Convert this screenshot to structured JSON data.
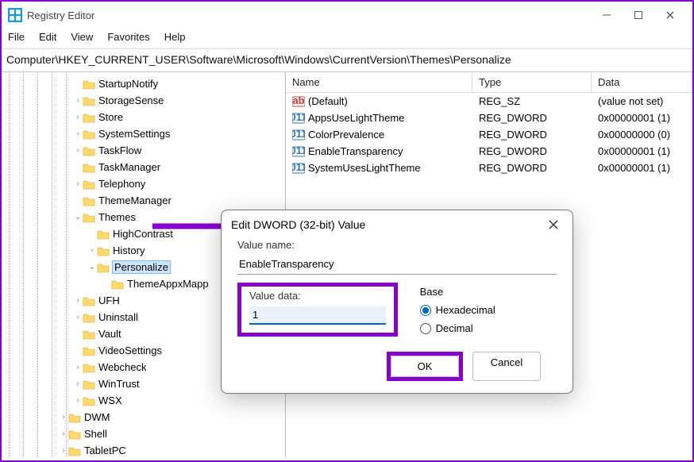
{
  "window": {
    "title": "Registry Editor"
  },
  "menu": {
    "file": "File",
    "edit": "Edit",
    "view": "View",
    "favorites": "Favorites",
    "help": "Help"
  },
  "path": "Computer\\HKEY_CURRENT_USER\\Software\\Microsoft\\Windows\\CurrentVersion\\Themes\\Personalize",
  "columns": {
    "name": "Name",
    "type": "Type",
    "data": "Data"
  },
  "values": [
    {
      "icon": "ab",
      "name": "(Default)",
      "type": "REG_SZ",
      "data": "(value not set)"
    },
    {
      "icon": "bin",
      "name": "AppsUseLightTheme",
      "type": "REG_DWORD",
      "data": "0x00000001 (1)"
    },
    {
      "icon": "bin",
      "name": "ColorPrevalence",
      "type": "REG_DWORD",
      "data": "0x00000000 (0)"
    },
    {
      "icon": "bin",
      "name": "EnableTransparency",
      "type": "REG_DWORD",
      "data": "0x00000001 (1)"
    },
    {
      "icon": "bin",
      "name": "SystemUsesLightTheme",
      "type": "REG_DWORD",
      "data": "0x00000001 (1)"
    }
  ],
  "tree": {
    "nodes": [
      {
        "depth": 4,
        "exp": "",
        "label": "StartupNotify"
      },
      {
        "depth": 4,
        "exp": ">",
        "label": "StorageSense"
      },
      {
        "depth": 4,
        "exp": ">",
        "label": "Store"
      },
      {
        "depth": 4,
        "exp": ">",
        "label": "SystemSettings"
      },
      {
        "depth": 4,
        "exp": ">",
        "label": "TaskFlow"
      },
      {
        "depth": 4,
        "exp": "",
        "label": "TaskManager"
      },
      {
        "depth": 4,
        "exp": ">",
        "label": "Telephony"
      },
      {
        "depth": 4,
        "exp": "",
        "label": "ThemeManager"
      },
      {
        "depth": 4,
        "exp": "v",
        "label": "Themes"
      },
      {
        "depth": 5,
        "exp": "",
        "label": "HighContrast"
      },
      {
        "depth": 5,
        "exp": ">",
        "label": "History"
      },
      {
        "depth": 5,
        "exp": "v",
        "label": "Personalize",
        "selected": true
      },
      {
        "depth": 6,
        "exp": "",
        "label": "ThemeAppxMapp"
      },
      {
        "depth": 4,
        "exp": ">",
        "label": "UFH"
      },
      {
        "depth": 4,
        "exp": ">",
        "label": "Uninstall"
      },
      {
        "depth": 4,
        "exp": "",
        "label": "Vault"
      },
      {
        "depth": 4,
        "exp": "",
        "label": "VideoSettings"
      },
      {
        "depth": 4,
        "exp": ">",
        "label": "Webcheck"
      },
      {
        "depth": 4,
        "exp": ">",
        "label": "WinTrust"
      },
      {
        "depth": 4,
        "exp": ">",
        "label": "WSX"
      },
      {
        "depth": 3,
        "exp": ">",
        "label": "DWM"
      },
      {
        "depth": 3,
        "exp": ">",
        "label": "Shell"
      },
      {
        "depth": 3,
        "exp": ">",
        "label": "TabletPC"
      }
    ]
  },
  "dialog": {
    "title": "Edit DWORD (32-bit) Value",
    "valuename_label": "Value name:",
    "valuename": "EnableTransparency",
    "valuedata_label": "Value data:",
    "valuedata": "1",
    "base_label": "Base",
    "hex": "Hexadecimal",
    "dec": "Decimal",
    "ok": "OK",
    "cancel": "Cancel"
  }
}
